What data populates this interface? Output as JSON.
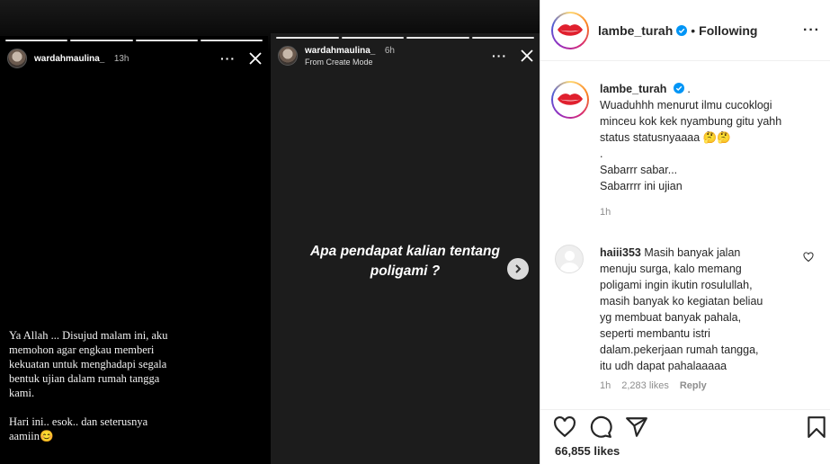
{
  "story_one": {
    "username": "wardahmaulina_",
    "time": "13h",
    "text_lines": [
      "Ya Allah ... Disujud malam ini, aku",
      "memohon agar engkau memberi",
      "kekuatan untuk menghadapi segala",
      "bentuk ujian dalam rumah tangga",
      "kami."
    ],
    "text_lines_2": [
      "Hari ini.. esok.. dan seterusnya",
      "aamiin😊"
    ]
  },
  "story_two": {
    "username": "wardahmaulina_",
    "time": "6h",
    "subtitle": "From Create Mode",
    "caption": "Apa pendapat kalian tentang poligami ?"
  },
  "post": {
    "handle": "lambe_turah",
    "follow_state": "Following",
    "accent": "#0095f6",
    "caption_suffix": ".",
    "caption_lines": [
      "Wuaduhhh menurut ilmu cucoklogi",
      "minceu kok kek nyambung gitu yahh",
      "status statusnyaaaa 🤔🤔",
      ".",
      "Sabarrr sabar...",
      "Sabarrrr ini ujian"
    ],
    "caption_time": "1h",
    "comment": {
      "user": "haiii353",
      "first_line": "Masih banyak jalan",
      "lines": [
        "menuju surga, kalo memang",
        "poligami ingin ikutin rosulullah,",
        "masih banyak ko kegiatan beliau",
        "yg membuat banyak pahala,",
        "seperti membantu istri",
        "dalam.pekerjaan rumah tangga,",
        "itu udh dapat pahalaaaaa"
      ],
      "time": "1h",
      "likes": "2,283 likes",
      "reply_label": "Reply"
    },
    "likes": "66,855 likes"
  },
  "icons": [
    "dots-icon",
    "close-icon",
    "chevron-right-icon",
    "verified-icon",
    "heart-icon",
    "comment-icon",
    "share-icon",
    "bookmark-icon"
  ]
}
